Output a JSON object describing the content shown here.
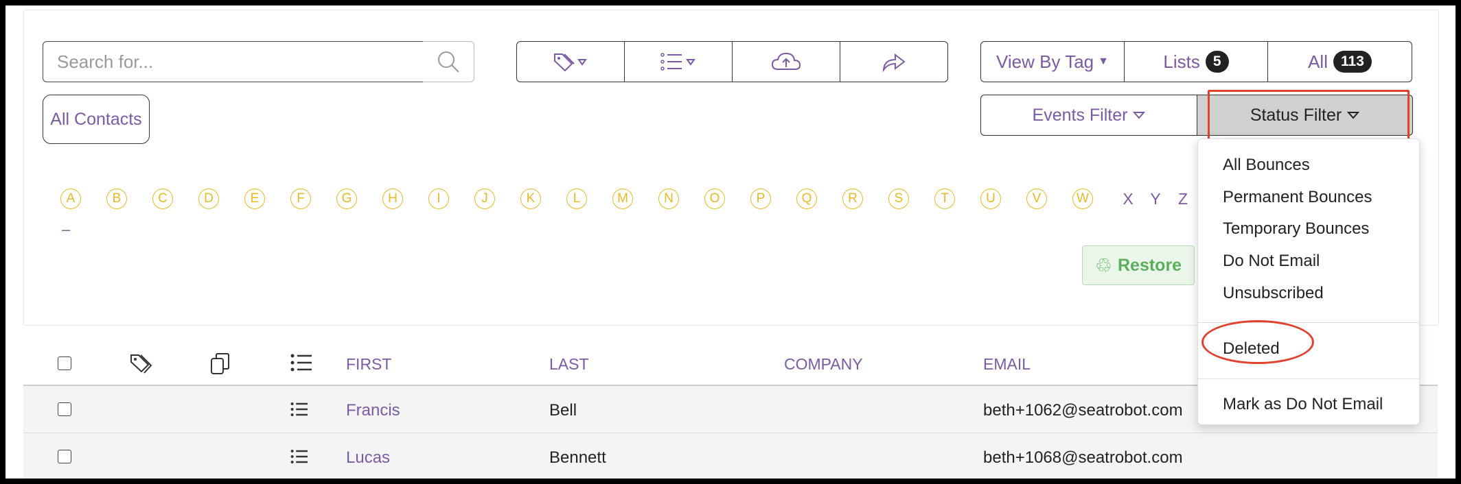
{
  "toolbar": {
    "search_placeholder": "Search for...",
    "view_by_tag": "View By Tag",
    "lists_label": "Lists",
    "lists_count": "5",
    "all_label": "All",
    "all_count": "113"
  },
  "filters": {
    "all_contacts": "All Contacts",
    "events_filter": "Events Filter",
    "status_filter": "Status Filter"
  },
  "alphabet": {
    "circled": [
      "A",
      "B",
      "C",
      "D",
      "E",
      "F",
      "G",
      "H",
      "I",
      "J",
      "K",
      "L",
      "M",
      "N",
      "O",
      "P",
      "Q",
      "R",
      "S",
      "T",
      "U",
      "V",
      "W"
    ],
    "plain": [
      "X",
      "Y",
      "Z"
    ],
    "extra": "–"
  },
  "restore_label": "Restore",
  "status_menu": {
    "items": [
      "All Bounces",
      "Permanent Bounces",
      "Temporary Bounces",
      "Do Not Email",
      "Unsubscribed"
    ],
    "deleted": "Deleted",
    "mark_dne": "Mark as Do Not Email"
  },
  "table": {
    "headers": {
      "first": "FIRST",
      "last": "LAST",
      "company": "COMPANY",
      "email": "EMAIL"
    },
    "rows": [
      {
        "first": "Francis",
        "last": "Bell",
        "company": "",
        "email": "beth+1062@seatrobot.com"
      },
      {
        "first": "Lucas",
        "last": "Bennett",
        "company": "",
        "email": "beth+1068@seatrobot.com"
      }
    ]
  },
  "colors": {
    "accent": "#7b5aa6",
    "letter": "#e8b923",
    "highlight": "#e0422b",
    "restore": "#5cae5c"
  }
}
